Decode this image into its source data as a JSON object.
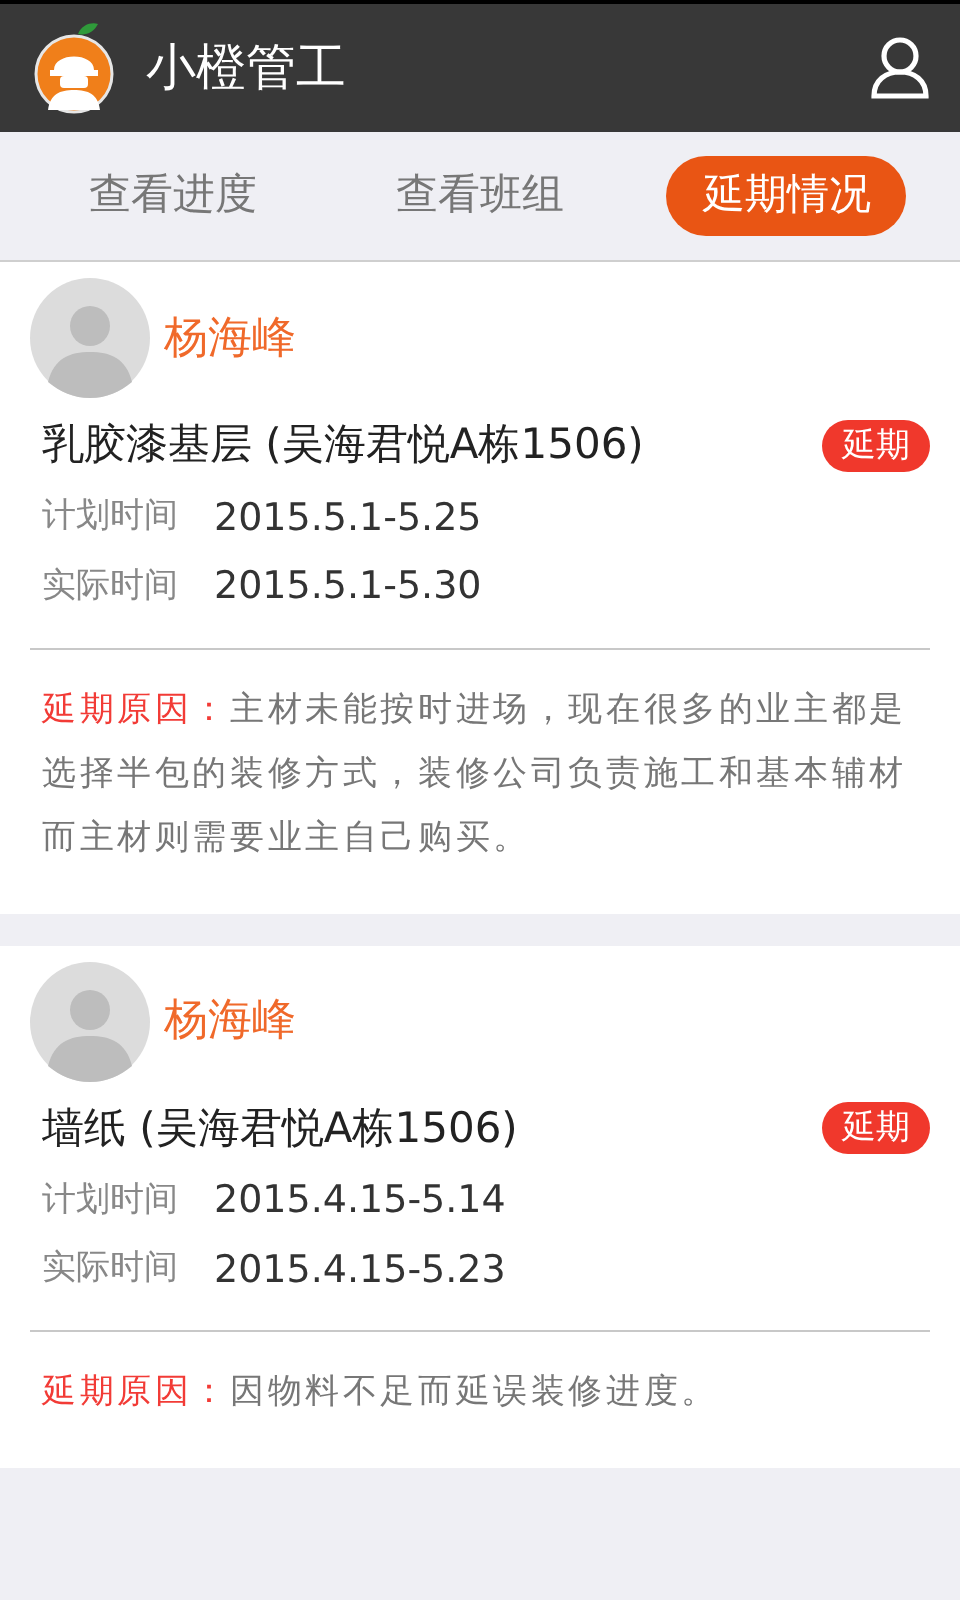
{
  "header": {
    "title": "小橙管工"
  },
  "tabs": [
    {
      "label": "查看进度",
      "selected": false
    },
    {
      "label": "查看班组",
      "selected": false
    },
    {
      "label": "延期情况",
      "selected": true
    }
  ],
  "records": [
    {
      "worker": "杨海峰",
      "task": "乳胶漆基层 (吴海君悦A栋1506)",
      "badge": "延期",
      "plan_label": "计划时间",
      "plan": "2015.5.1-5.25",
      "actual_label": "实际时间",
      "actual": "2015.5.1-5.30",
      "reason_label": "延期原因：",
      "reason": "主材未能按时进场，现在很多的业主都是选择半包的装修方式，装修公司负责施工和基本辅材而主材则需要业主自己购买。"
    },
    {
      "worker": "杨海峰",
      "task": "墙纸 (吴海君悦A栋1506)",
      "badge": "延期",
      "plan_label": "计划时间",
      "plan": "2015.4.15-5.14",
      "actual_label": "实际时间",
      "actual": "2015.4.15-5.23",
      "reason_label": "延期原因：",
      "reason": "因物料不足而延误装修进度。"
    }
  ]
}
